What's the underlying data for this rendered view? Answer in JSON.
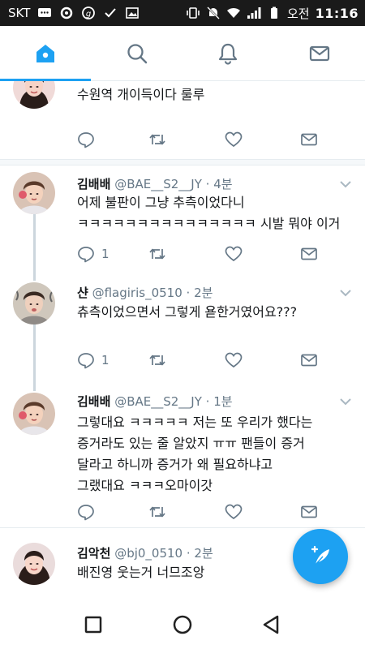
{
  "statusbar": {
    "carrier": "SKT",
    "ampm": "오전",
    "time": "11:16",
    "icons": [
      "message-icon",
      "circle-icon",
      "g-icon",
      "check-icon",
      "image-icon",
      "vibrate-icon",
      "mute-icon",
      "wifi-icon",
      "signal-icon",
      "battery-icon"
    ]
  },
  "tabs": [
    {
      "name": "home",
      "icon": "home-icon",
      "active": true
    },
    {
      "name": "search",
      "icon": "search-icon",
      "active": false
    },
    {
      "name": "notifications",
      "icon": "bell-icon",
      "active": false
    },
    {
      "name": "messages",
      "icon": "mail-icon",
      "active": false
    }
  ],
  "colors": {
    "accent": "#1da1f2",
    "muted": "#657786",
    "line": "#e6ecf0"
  },
  "tweets": [
    {
      "name": "",
      "handle": "",
      "time": "",
      "text": "수원역 개이득이다 룰루",
      "replies": "",
      "partial": true
    },
    {
      "name": "김배배",
      "handle": "@BAE__S2__JY",
      "time": "· 4분",
      "text": "어제 불판이 그냥 추측이었다니\nㅋㅋㅋㅋㅋㅋㅋㅋㅋㅋㅋㅋㅋㅋㅋ 시발 뭐야 이거",
      "replies": "1"
    },
    {
      "name": "샨",
      "handle": "@flagiris_0510",
      "time": "· 2분",
      "text": "츄측이었으면서 그렇게 욛한거였어요???",
      "replies": "1"
    },
    {
      "name": "김배배",
      "handle": "@BAE__S2__JY",
      "time": "· 1분",
      "text": "그렇대요 ㅋㅋㅋㅋㅋ 저는 또 우리가 했다는\n증거라도 있는 줄 알았지 ㅠㅠ 팬들이 증거\n달라고 하니까 증거가 왜 필요하냐고\n그랬대요 ㅋㅋㅋ오마이갓",
      "replies": ""
    },
    {
      "name": "김악천",
      "handle": "@bj0_0510",
      "time": "· 2분",
      "text": "배진영 웃는거 너므조앙",
      "replies": ""
    }
  ],
  "navbar": [
    "recents-icon",
    "home-circle-icon",
    "back-icon"
  ],
  "fab": {
    "icon": "compose-feather-icon"
  }
}
